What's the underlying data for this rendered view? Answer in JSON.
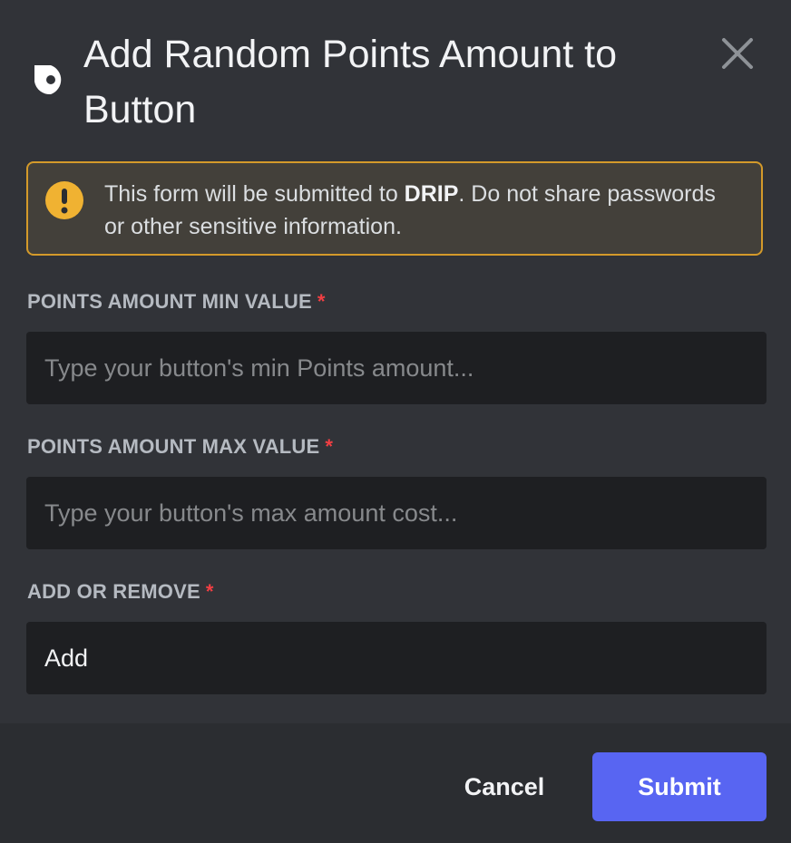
{
  "modal": {
    "title": "Add Random Points Amount to Button",
    "app_icon": "app-logo-icon",
    "close_icon": "close-icon"
  },
  "warning": {
    "icon": "warning-icon",
    "text_prefix": "This form will be submitted to ",
    "app_name": "DRIP",
    "text_suffix": ". Do not share passwords or other sensitive information.",
    "border_color": "#d49a2a",
    "icon_color": "#f0b232"
  },
  "fields": [
    {
      "label": "POINTS AMOUNT MIN VALUE",
      "required_mark": "*",
      "placeholder": "Type your button's min Points amount...",
      "value": ""
    },
    {
      "label": "POINTS AMOUNT MAX VALUE",
      "required_mark": "*",
      "placeholder": "Type your button's max amount cost...",
      "value": ""
    },
    {
      "label": "ADD OR REMOVE",
      "required_mark": "*",
      "value": "Add"
    }
  ],
  "footer": {
    "cancel_label": "Cancel",
    "submit_label": "Submit",
    "submit_color": "#5865f2"
  }
}
